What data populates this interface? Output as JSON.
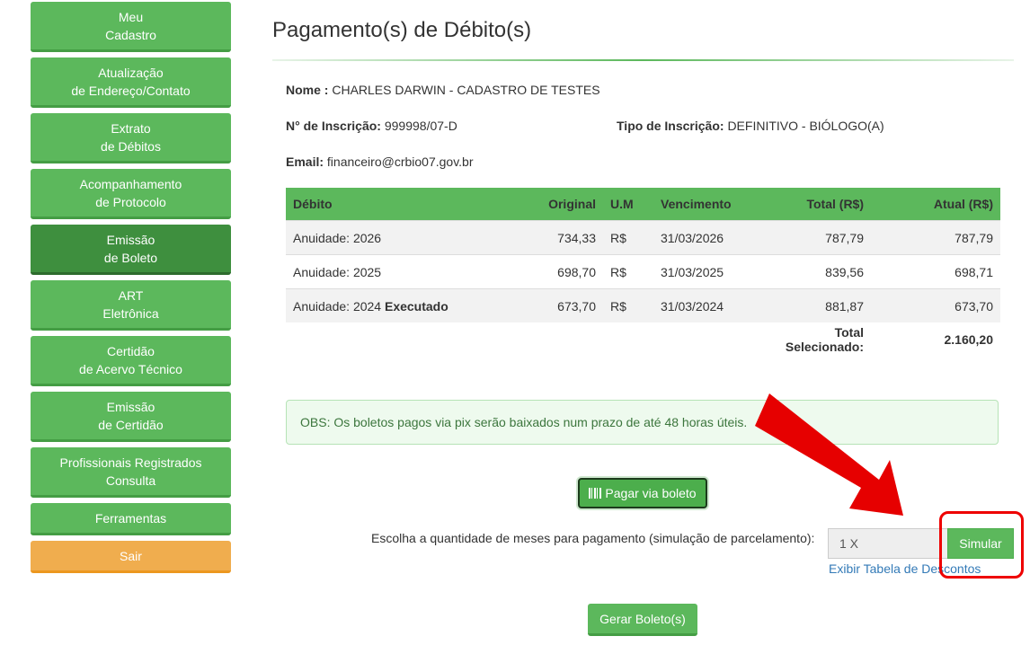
{
  "sidebar": {
    "items": [
      {
        "label": "Meu\nCadastro"
      },
      {
        "label": "Atualização\nde Endereço/Contato"
      },
      {
        "label": "Extrato\nde Débitos"
      },
      {
        "label": "Acompanhamento\nde Protocolo"
      },
      {
        "label": "Emissão\nde Boleto",
        "active": true
      },
      {
        "label": "ART\nEletrônica"
      },
      {
        "label": "Certidão\nde Acervo Técnico"
      },
      {
        "label": "Emissão\nde Certidão"
      },
      {
        "label": "Profissionais Registrados\nConsulta"
      },
      {
        "label": "Ferramentas"
      },
      {
        "label": "Sair"
      }
    ]
  },
  "page": {
    "title": "Pagamento(s) de Débito(s)"
  },
  "info": {
    "name_label": "Nome :",
    "name_value": "CHARLES DARWIN - CADASTRO DE TESTES",
    "inscricao_label": "N° de Inscrição:",
    "inscricao_value": "999998/07-D",
    "tipo_label": "Tipo de Inscrição:",
    "tipo_value": "DEFINITIVO - BIÓLOGO(A)",
    "email_label": "Email:",
    "email_value": "financeiro@crbio07.gov.br"
  },
  "table": {
    "headers": {
      "debito": "Débito",
      "original": "Original",
      "um": "U.M",
      "vencimento": "Vencimento",
      "total": "Total (R$)",
      "atual": "Atual (R$)"
    },
    "rows": [
      {
        "debito": "Anuidade: 2026",
        "status": "",
        "original": "734,33",
        "um": "R$",
        "vencimento": "31/03/2026",
        "total": "787,79",
        "atual": "787,79"
      },
      {
        "debito": "Anuidade: 2025",
        "status": "",
        "original": "698,70",
        "um": "R$",
        "vencimento": "31/03/2025",
        "total": "839,56",
        "atual": "698,71"
      },
      {
        "debito": "Anuidade: 2024",
        "status": "Executado",
        "original": "673,70",
        "um": "R$",
        "vencimento": "31/03/2024",
        "total": "881,87",
        "atual": "673,70"
      }
    ],
    "total_label": "Total Selecionado:",
    "total_value": "2.160,20"
  },
  "obs": {
    "text": "OBS: Os boletos pagos via pix serão baixados num prazo de até 48 horas úteis."
  },
  "actions": {
    "pay_label": "Pagar via boleto",
    "months_label": "Escolha a quantidade de meses para pagamento (simulação de parcelamento):",
    "months_value": "1 X",
    "simular_label": "Simular",
    "discount_link": "Exibir Tabela de Descontos",
    "gerar_label": "Gerar Boleto(s)"
  },
  "colors": {
    "primary": "#5cb85c",
    "active": "#3e8f3e",
    "exit": "#f0ad4e",
    "annotation": "#e00000"
  }
}
